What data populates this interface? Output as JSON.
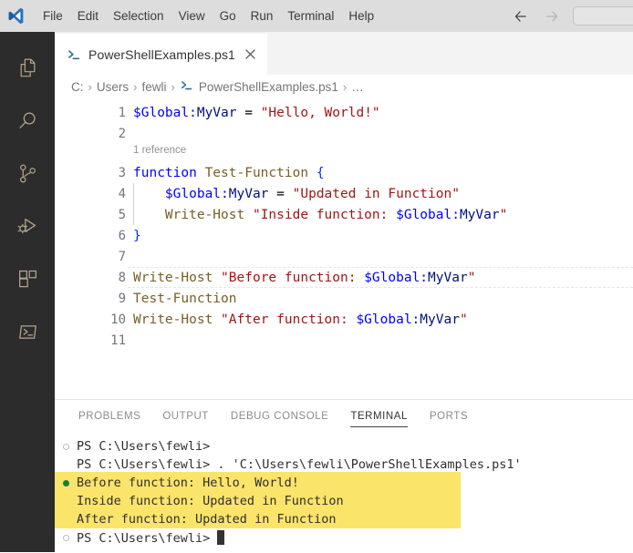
{
  "window": {
    "titlebar_bg": "#dddddd",
    "accent": "#0065a9"
  },
  "menu": {
    "logo_name": "vscode-logo",
    "items": [
      {
        "label": "File"
      },
      {
        "label": "Edit"
      },
      {
        "label": "Selection"
      },
      {
        "label": "View"
      },
      {
        "label": "Go"
      },
      {
        "label": "Run"
      },
      {
        "label": "Terminal"
      },
      {
        "label": "Help"
      }
    ],
    "nav": {
      "back_icon": "arrow-left-icon",
      "forward_icon": "arrow-right-icon"
    },
    "command_center_placeholder": ""
  },
  "activitybar": {
    "items": [
      {
        "name": "explorer",
        "icon": "files-icon",
        "label": "Explorer"
      },
      {
        "name": "search",
        "icon": "search-icon",
        "label": "Search"
      },
      {
        "name": "source-control",
        "icon": "source-control-icon",
        "label": "Source Control"
      },
      {
        "name": "run-debug",
        "icon": "run-and-debug-icon",
        "label": "Run and Debug"
      },
      {
        "name": "extensions",
        "icon": "extensions-icon",
        "label": "Extensions"
      },
      {
        "name": "terminal",
        "icon": "terminal-icon",
        "label": "Terminal"
      }
    ]
  },
  "tabs": [
    {
      "label": "PowerShellExamples.ps1",
      "icon": "powershell-file-icon",
      "active": true,
      "close_icon": "close-icon"
    }
  ],
  "breadcrumb": {
    "items": [
      {
        "label": "C:",
        "icon": ""
      },
      {
        "label": "Users",
        "icon": ""
      },
      {
        "label": "fewli",
        "icon": ""
      },
      {
        "label": "PowerShellExamples.ps1",
        "icon": "powershell-file-icon"
      },
      {
        "label": "…",
        "icon": ""
      }
    ],
    "separator": "›"
  },
  "editor": {
    "codelens": {
      "line_after": 2,
      "label": "1 reference"
    },
    "current_line": 8,
    "lines": [
      {
        "number": "1",
        "text": "$Global:MyVar = \"Hello, World!\"",
        "tokens": [
          {
            "t": "$Global:",
            "c": "t-var"
          },
          {
            "t": "MyVar",
            "c": "t-varname"
          },
          {
            "t": " ",
            "c": "t-plain"
          },
          {
            "t": "=",
            "c": "t-op"
          },
          {
            "t": " ",
            "c": "t-plain"
          },
          {
            "t": "\"Hello, World!\"",
            "c": "t-str"
          }
        ]
      },
      {
        "number": "2",
        "text": "",
        "tokens": []
      },
      {
        "number": "3",
        "text": "function Test-Function {",
        "tokens": [
          {
            "t": "function",
            "c": "t-kw"
          },
          {
            "t": " ",
            "c": "t-plain"
          },
          {
            "t": "Test-Function",
            "c": "t-cmd"
          },
          {
            "t": " ",
            "c": "t-plain"
          },
          {
            "t": "{",
            "c": "t-punct"
          }
        ]
      },
      {
        "number": "4",
        "text": "    $Global:MyVar = \"Updated in Function\"",
        "tokens": [
          {
            "t": "    ",
            "c": "t-plain"
          },
          {
            "t": "$Global:",
            "c": "t-var"
          },
          {
            "t": "MyVar",
            "c": "t-varname"
          },
          {
            "t": " ",
            "c": "t-plain"
          },
          {
            "t": "=",
            "c": "t-op"
          },
          {
            "t": " ",
            "c": "t-plain"
          },
          {
            "t": "\"Updated in Function\"",
            "c": "t-str"
          }
        ]
      },
      {
        "number": "5",
        "text": "    Write-Host \"Inside function: $Global:MyVar\"",
        "tokens": [
          {
            "t": "    ",
            "c": "t-plain"
          },
          {
            "t": "Write-Host",
            "c": "t-cmd"
          },
          {
            "t": " ",
            "c": "t-plain"
          },
          {
            "t": "\"Inside function: ",
            "c": "t-str"
          },
          {
            "t": "$Global:",
            "c": "t-var"
          },
          {
            "t": "MyVar",
            "c": "t-varname"
          },
          {
            "t": "\"",
            "c": "t-str"
          }
        ]
      },
      {
        "number": "6",
        "text": "}",
        "tokens": [
          {
            "t": "}",
            "c": "t-punct"
          }
        ]
      },
      {
        "number": "7",
        "text": "",
        "tokens": []
      },
      {
        "number": "8",
        "text": "Write-Host \"Before function: $Global:MyVar\"",
        "tokens": [
          {
            "t": "Write-Host",
            "c": "t-cmd"
          },
          {
            "t": " ",
            "c": "t-plain"
          },
          {
            "t": "\"Before function: ",
            "c": "t-str"
          },
          {
            "t": "$Global:",
            "c": "t-var"
          },
          {
            "t": "MyVar",
            "c": "t-varname"
          },
          {
            "t": "\"",
            "c": "t-str"
          }
        ]
      },
      {
        "number": "9",
        "text": "Test-Function",
        "tokens": [
          {
            "t": "Test-Function",
            "c": "t-cmd"
          }
        ]
      },
      {
        "number": "10",
        "text": "Write-Host \"After function: $Global:MyVar\"",
        "tokens": [
          {
            "t": "Write-Host",
            "c": "t-cmd"
          },
          {
            "t": " ",
            "c": "t-plain"
          },
          {
            "t": "\"After function: ",
            "c": "t-str"
          },
          {
            "t": "$Global:",
            "c": "t-var"
          },
          {
            "t": "MyVar",
            "c": "t-varname"
          },
          {
            "t": "\"",
            "c": "t-str"
          }
        ]
      },
      {
        "number": "11",
        "text": "",
        "tokens": []
      }
    ]
  },
  "panel": {
    "tabs": [
      {
        "label": "PROBLEMS",
        "active": false
      },
      {
        "label": "OUTPUT",
        "active": false
      },
      {
        "label": "DEBUG CONSOLE",
        "active": false
      },
      {
        "label": "TERMINAL",
        "active": true
      },
      {
        "label": "PORTS",
        "active": false
      }
    ]
  },
  "terminal": {
    "highlight_color": "#fbe46a",
    "success_color": "#1a7f37",
    "lines": [
      {
        "deco": "idle",
        "text": "PS C:\\Users\\fewli>",
        "highlight": false,
        "cursor": false
      },
      {
        "deco": "none",
        "text": "PS C:\\Users\\fewli> . 'C:\\Users\\fewli\\PowerShellExamples.ps1'",
        "highlight": false,
        "cursor": false
      },
      {
        "deco": "ok",
        "text": "Before function: Hello, World!",
        "highlight": true,
        "cursor": false
      },
      {
        "deco": "none",
        "text": "Inside function: Updated in Function",
        "highlight": true,
        "cursor": false
      },
      {
        "deco": "none",
        "text": "After function: Updated in Function",
        "highlight": true,
        "cursor": false
      },
      {
        "deco": "idle",
        "text": "PS C:\\Users\\fewli> ",
        "highlight": false,
        "cursor": true
      }
    ]
  }
}
